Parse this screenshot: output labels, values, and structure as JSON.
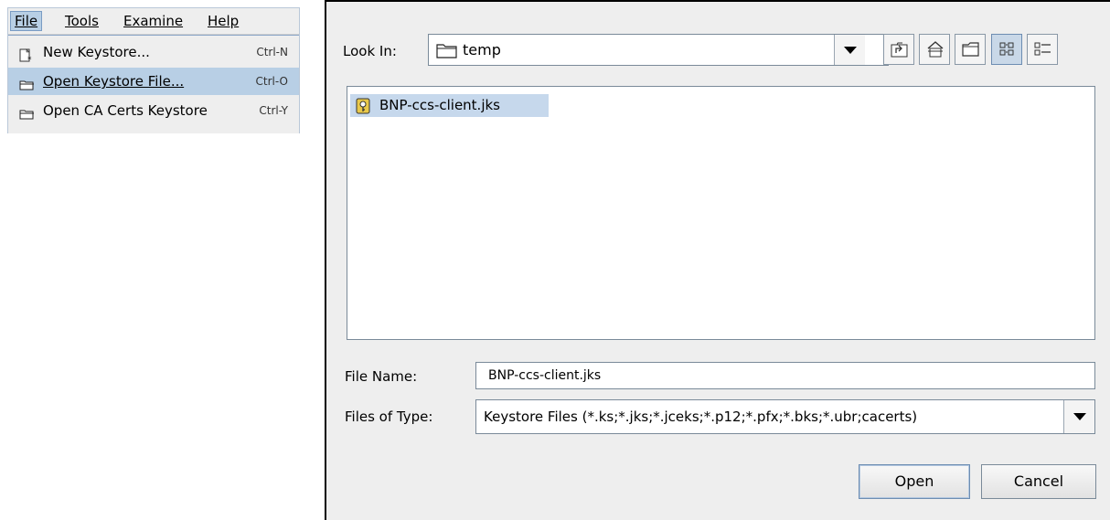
{
  "menubar": {
    "file": "File",
    "tools": "Tools",
    "examine": "Examine",
    "help": "Help"
  },
  "file_menu": {
    "items": [
      {
        "label": "New Keystore...",
        "accel": "Ctrl-N",
        "icon": "new-keystore-icon"
      },
      {
        "label": "Open Keystore File...",
        "accel": "Ctrl-O",
        "icon": "open-folder-icon",
        "highlighted": true
      },
      {
        "label": "Open CA Certs Keystore",
        "accel": "Ctrl-Y",
        "icon": "open-folder-icon"
      }
    ]
  },
  "dialog": {
    "look_in_label": "Look In:",
    "look_in_value": "temp",
    "toolbar": [
      "up-one-level-icon",
      "home-icon",
      "new-folder-icon",
      "list-view-icon",
      "details-view-icon"
    ],
    "files": [
      {
        "name": "BNP-ccs-client.jks",
        "icon": "keystore-file-icon",
        "selected": true
      }
    ],
    "file_name_label": "File Name:",
    "file_name_value": "BNP-ccs-client.jks",
    "files_of_type_label": "Files of Type:",
    "files_of_type_value": "Keystore Files (*.ks;*.jks;*.jceks;*.p12;*.pfx;*.bks;*.ubr;cacerts)",
    "open_button": "Open",
    "cancel_button": "Cancel"
  },
  "colors": {
    "selection": "#c6d8ec",
    "menu_highlight": "#b8cfe5",
    "dialog_bg": "#eeeeee"
  }
}
